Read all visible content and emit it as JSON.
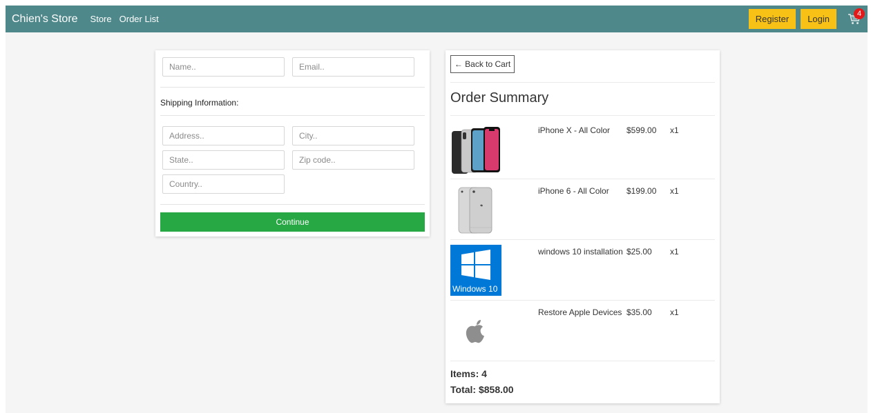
{
  "nav": {
    "brand": "Chien's Store",
    "links": [
      "Store",
      "Order List"
    ],
    "register_label": "Register",
    "login_label": "Login",
    "cart_count": "4"
  },
  "form": {
    "name_placeholder": "Name..",
    "email_placeholder": "Email..",
    "shipping_label": "Shipping Information:",
    "address_placeholder": "Address..",
    "city_placeholder": "City..",
    "state_placeholder": "State..",
    "zip_placeholder": "Zip code..",
    "country_placeholder": "Country..",
    "continue_label": "Continue"
  },
  "summary": {
    "back_label": "← Back to Cart",
    "title": "Order Summary",
    "items": [
      {
        "name": "iPhone X - All Color",
        "price": "$599.00",
        "qty": "x1",
        "icon": "iphone-x-image"
      },
      {
        "name": "iPhone 6 - All Color",
        "price": "$199.00",
        "qty": "x1",
        "icon": "iphone-6-image"
      },
      {
        "name": "windows 10 installation",
        "price": "$25.00",
        "qty": "x1",
        "icon": "windows-10-image",
        "image_text": "Windows 10"
      },
      {
        "name": "Restore Apple Devices",
        "price": "$35.00",
        "qty": "x1",
        "icon": "apple-logo-image"
      }
    ],
    "items_count_label": "Items: 4",
    "total_label": "Total: $858.00"
  },
  "colors": {
    "navbar": "#4f888a",
    "nav_button": "#f8c116",
    "continue_button": "#28a745",
    "cart_badge": "#e21a1a",
    "windows_blue": "#0078d7"
  }
}
